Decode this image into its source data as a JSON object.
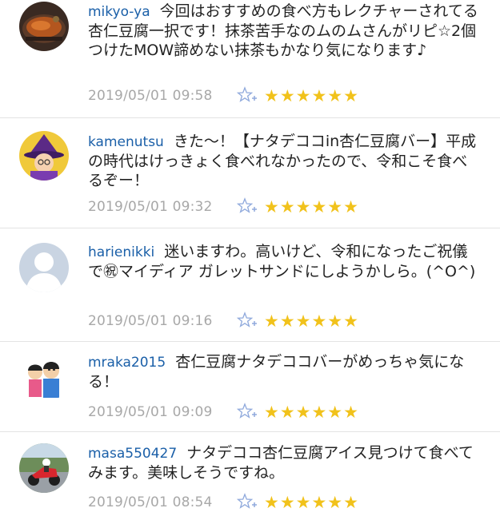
{
  "comments": [
    {
      "username": "mikyo-ya",
      "text": "今回はおすすめの食べ方もレクチャーされてる杏仁豆腐一択です！抹茶苦手なのムのムさんがリピ☆2個つけたMOW諦めない抹茶もかなり気になります♪",
      "timestamp": "2019/05/01 09:58",
      "rating": 6,
      "stars": "★★★★★★",
      "avatar": "food-photo-avatar"
    },
    {
      "username": "kamenutsu",
      "text": "きた〜！【ナタデココin杏仁豆腐バー】平成の時代はけっきょく食べれなかったので、令和こそ食べるぞー！",
      "timestamp": "2019/05/01 09:32",
      "rating": 6,
      "stars": "★★★★★★",
      "avatar": "witch-illustration-avatar"
    },
    {
      "username": "harienikki",
      "text": "迷いますわ。高いけど、令和になったご祝儀で㊗マイディア ガレットサンドにしようかしら。(^O^)",
      "timestamp": "2019/05/01 09:16",
      "rating": 6,
      "stars": "★★★★★★",
      "avatar": "default-person-avatar"
    },
    {
      "username": "mraka2015",
      "text": "杏仁豆腐ナタデココバーがめっちゃ気になる！",
      "timestamp": "2019/05/01 09:09",
      "rating": 6,
      "stars": "★★★★★★",
      "avatar": "family-illustration-avatar"
    },
    {
      "username": "masa550427",
      "text": "ナタデココ杏仁豆腐アイス見つけて食べてみます。美味しそうですね。",
      "timestamp": "2019/05/01 08:54",
      "rating": 6,
      "stars": "★★★★★★",
      "avatar": "motorbike-photo-avatar"
    }
  ],
  "colors": {
    "username": "#1a5fa8",
    "text": "#222222",
    "timestamp": "#a8a8a8",
    "star": "#f1c21b",
    "fav_icon": "#8fa9dc",
    "divider": "#e3e3e3"
  }
}
